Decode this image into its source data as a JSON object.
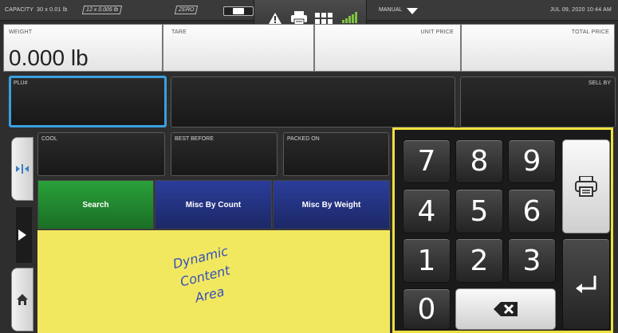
{
  "status_bar": {
    "capacity_label": "CAPACITY",
    "capacity_1": "30 x 0.01 lb",
    "capacity_2": "12 x 0.005 lb",
    "zero_label": "ZERO",
    "mode": "MANUAL",
    "datetime": "JUL 09, 2020 10:44 AM",
    "signal_color": "#7fc341",
    "icons": [
      "toggle-switch",
      "warning-icon",
      "printer-icon",
      "grid-icon",
      "signal-icon",
      "chevron-down-icon"
    ]
  },
  "fields": {
    "weight_label": "WEIGHT",
    "weight_value": "0.000 lb",
    "tare_label": "TARE",
    "unit_price_label": "UNIT PRICE",
    "total_price_label": "TOTAL PRICE",
    "plu_label": "PLU#",
    "sell_by_label": "SELL BY",
    "cool_label": "COOL",
    "best_before_label": "BEST BEFORE",
    "packed_on_label": "PACKED ON"
  },
  "actions": {
    "search_label": "Search",
    "misc_count_label": "Misc By Count",
    "misc_weight_label": "Misc By Weight",
    "search_color": "#2aa03a",
    "misc_color": "#2b3d9a"
  },
  "dynamic_area": {
    "line1": "Dynamic",
    "line2": "Content",
    "line3": "Area",
    "background": "#f2e860"
  },
  "keypad": {
    "keys": [
      "7",
      "8",
      "9",
      "4",
      "5",
      "6",
      "1",
      "2",
      "3",
      "0"
    ],
    "border_color": "#eee040",
    "icons": [
      "printer-icon",
      "backspace-icon",
      "enter-icon"
    ]
  },
  "rail": {
    "icons": [
      "collapse-icon",
      "arrow-right-icon",
      "home-icon"
    ]
  }
}
